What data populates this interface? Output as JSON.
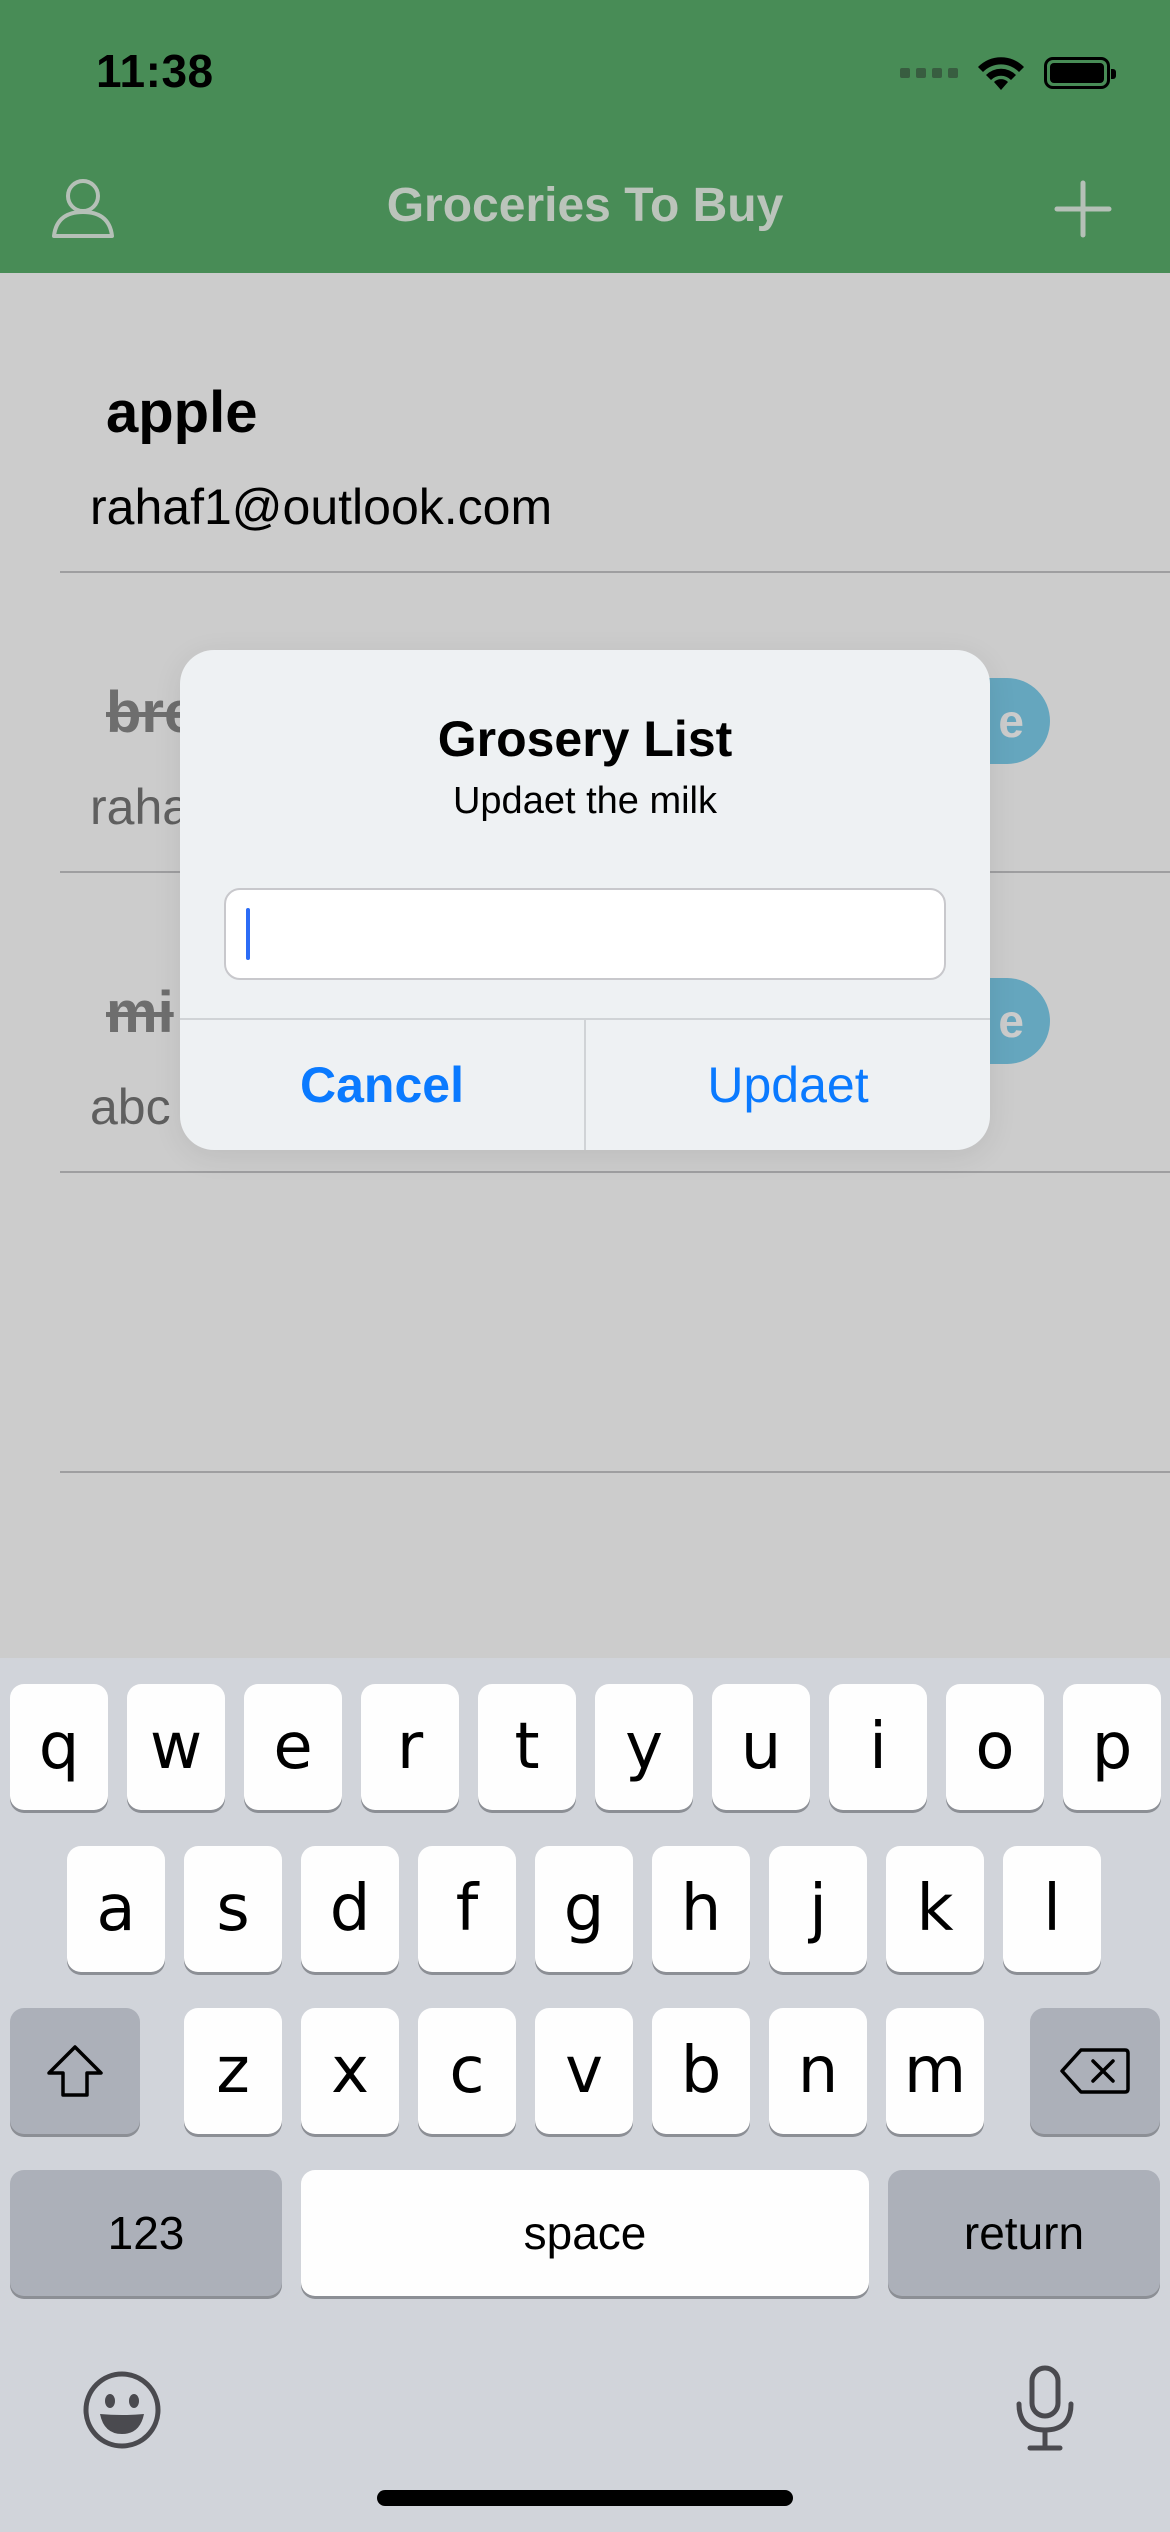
{
  "status_bar": {
    "time": "11:38"
  },
  "nav": {
    "title": "Groceries To Buy",
    "left_icon": "person-icon",
    "right_icon": "plus-icon"
  },
  "list": {
    "items": [
      {
        "title": "apple",
        "subtitle": "rahaf1@outlook.com",
        "completed": false
      },
      {
        "title": "bre",
        "subtitle": "raha",
        "completed": true,
        "action_label": "e"
      },
      {
        "title": "mi",
        "subtitle": "abc",
        "completed": true,
        "action_label": "e"
      }
    ]
  },
  "alert": {
    "title": "Grosery List",
    "message": "Updaet the milk",
    "input_value": "",
    "cancel_label": "Cancel",
    "confirm_label": "Updaet"
  },
  "keyboard": {
    "row1": [
      "q",
      "w",
      "e",
      "r",
      "t",
      "y",
      "u",
      "i",
      "o",
      "p"
    ],
    "row2": [
      "a",
      "s",
      "d",
      "f",
      "g",
      "h",
      "j",
      "k",
      "l"
    ],
    "row3": [
      "z",
      "x",
      "c",
      "v",
      "b",
      "n",
      "m"
    ],
    "numbers_label": "123",
    "space_label": "space",
    "return_label": "return",
    "shift_icon": "shift-icon",
    "delete_icon": "delete-icon",
    "emoji_icon": "emoji-icon",
    "mic_icon": "microphone-icon"
  },
  "colors": {
    "header": "#5aaf6c",
    "accent": "#0a7aff",
    "pill": "#7fd0ee"
  }
}
